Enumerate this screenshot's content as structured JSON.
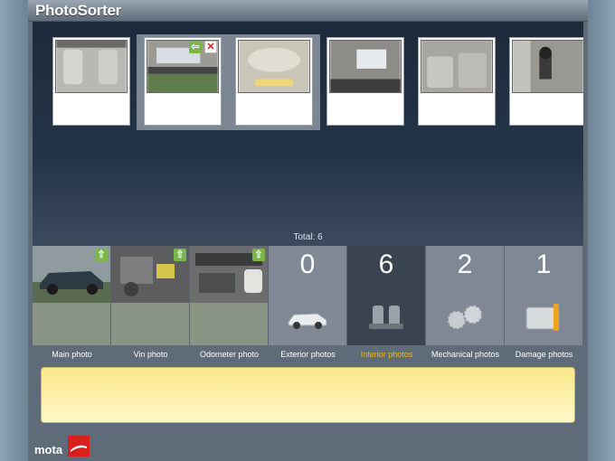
{
  "app": {
    "title": "PhotoSorter"
  },
  "viewer": {
    "total_label": "Total: 6",
    "thumbnails": [
      {
        "name": "interior-front-seats"
      },
      {
        "name": "sunroof"
      },
      {
        "name": "dome-light"
      },
      {
        "name": "sunroof-open"
      },
      {
        "name": "rear-seats"
      },
      {
        "name": "gear-shifter"
      }
    ]
  },
  "categories": [
    {
      "label": "Main photo",
      "kind": "photo"
    },
    {
      "label": "Vin photo",
      "kind": "photo"
    },
    {
      "label": "Odometer photo",
      "kind": "photo"
    },
    {
      "label": "Exterior photos",
      "kind": "count",
      "count": "0",
      "icon": "car-icon"
    },
    {
      "label": "Interior photos",
      "kind": "count",
      "count": "6",
      "icon": "seat-icon",
      "active": true
    },
    {
      "label": "Mechanical photos",
      "kind": "count",
      "count": "2",
      "icon": "gears-icon"
    },
    {
      "label": "Damage photos",
      "kind": "count",
      "count": "1",
      "icon": "bandage-icon"
    }
  ],
  "footer": {
    "brand": "mota"
  },
  "colors": {
    "active_label": "#f0b428",
    "note_area": "#fbe88a",
    "brand_red": "#d9201c"
  }
}
